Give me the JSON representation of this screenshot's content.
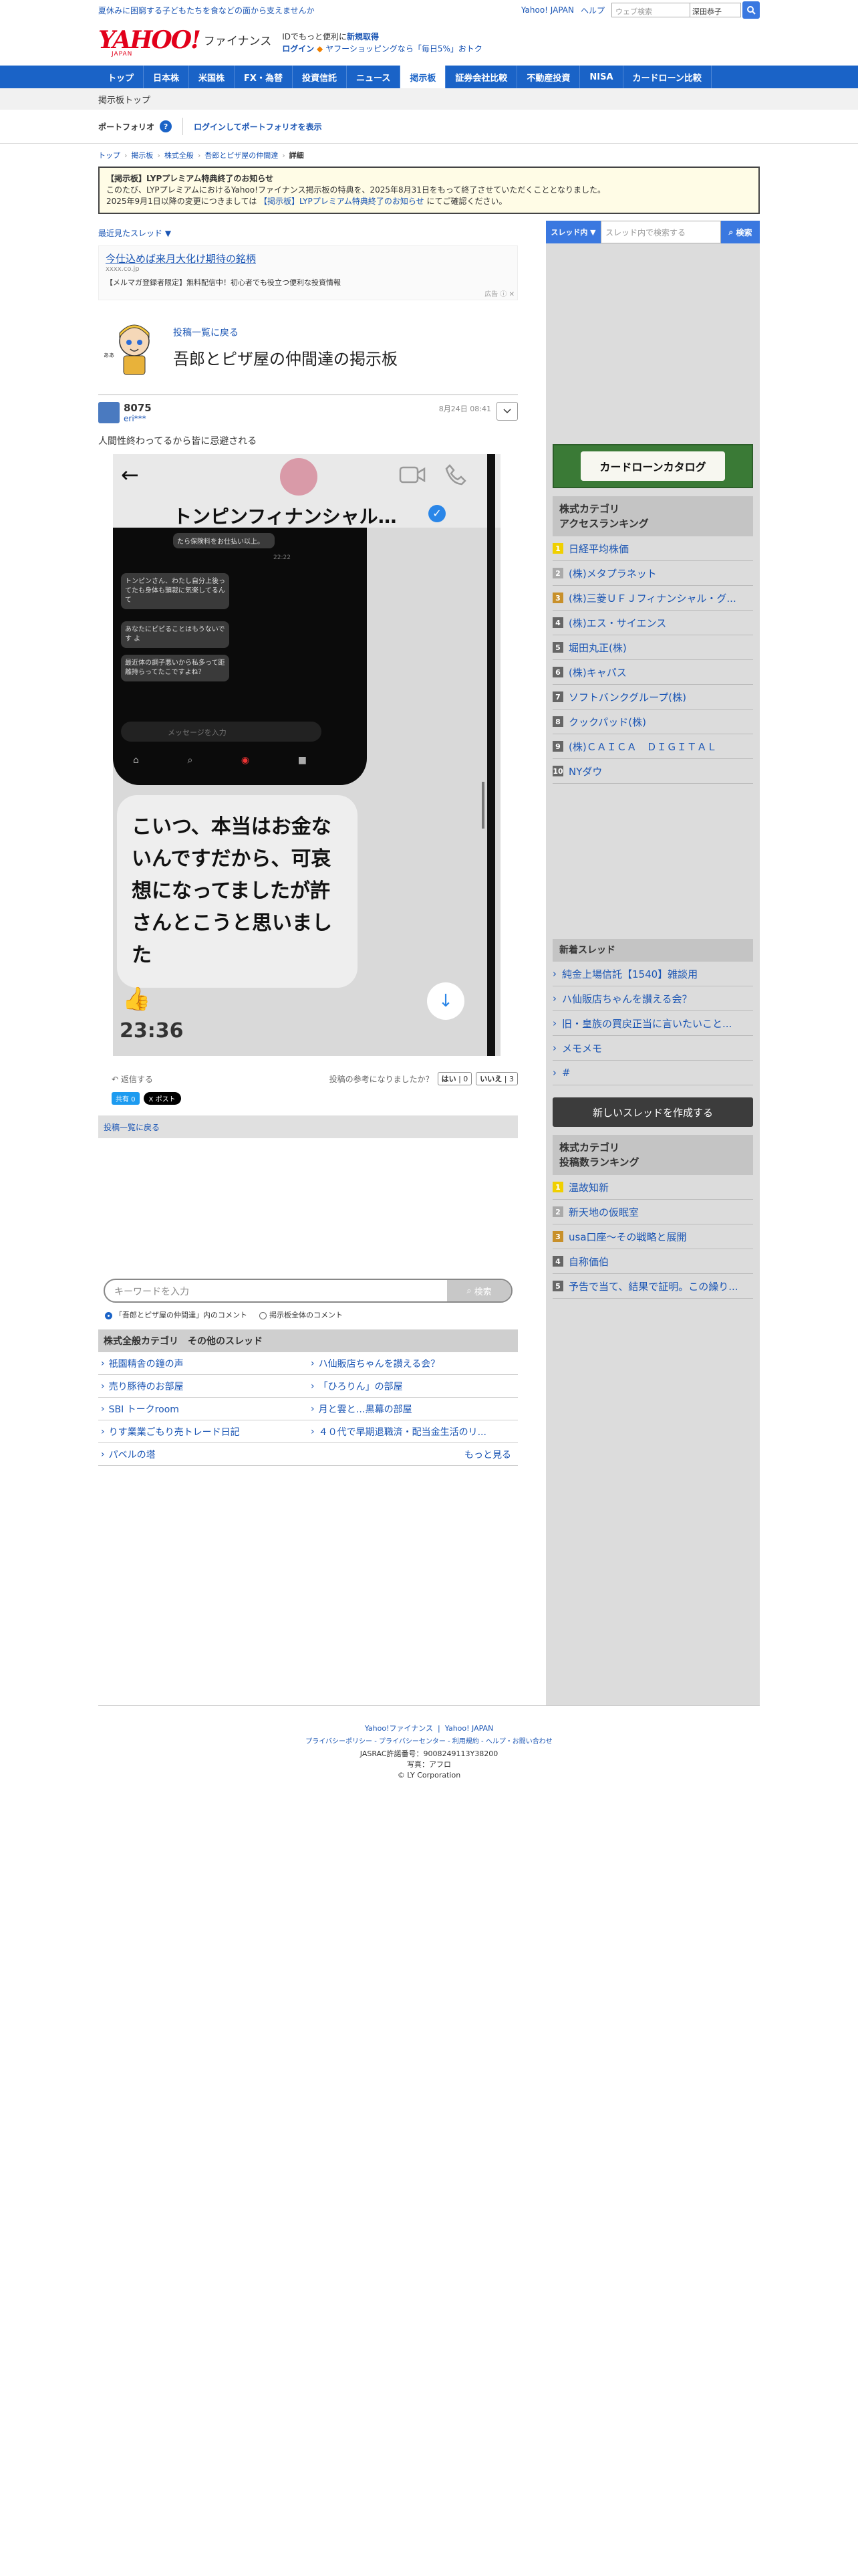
{
  "topbar": {
    "promo": "夏休みに困窮する子どもたちを食などの面から支えませんか",
    "links": [
      "Yahoo! JAPAN",
      "ヘルプ"
    ],
    "websearch_placeholder": "ウェブ検索",
    "user_label": "深田恭子"
  },
  "header": {
    "logo": "YAHOO!",
    "logo_sub": "JAPAN",
    "service": "ファイナンス",
    "msg_line1_pre": "IDでもっと便利に",
    "msg_line1_link": "新規取得",
    "msg_line2_login": "ログイン",
    "msg_line2_rest": "ヤフーショッピングなら「毎日5%」おトク"
  },
  "gnav": [
    "トップ",
    "日本株",
    "米国株",
    "FX・為替",
    "投資信託",
    "ニュース",
    "掲示板",
    "証券会社比較",
    "不動産投資",
    "NISA",
    "カードローン比較"
  ],
  "gnav_active": 6,
  "subtitle": "掲示板トップ",
  "portfolio": {
    "label": "ポートフォリオ",
    "help": "?",
    "login_link": "ログインしてポートフォリオを表示"
  },
  "breadcrumb": [
    "トップ",
    "掲示板",
    "株式全般",
    "吾郎とピザ屋の仲間達",
    "詳細"
  ],
  "notice": {
    "title": "【掲示板】LYPプレミアム特典終了のお知らせ",
    "line1": "このたび、LYPプレミアムにおけるYahoo!ファイナンス掲示板の特典を、2025年8月31日をもって終了させていただくこととなりました。",
    "line2_pre": "2025年9月1日以降の変更につきましては",
    "line2_link": "【掲示板】LYPプレミアム特典終了のお知らせ",
    "line2_post": "にてご確認ください。"
  },
  "recent_sort": "最近見たスレッド ▼",
  "ad": {
    "title": "今仕込めば来月大化け期待の銘柄",
    "domain": "xxxx.co.jp",
    "text": "【メルマガ登録者限定】無料配信中！初心者でも役立つ便利な投資情報",
    "mark": "広告"
  },
  "board": {
    "back": "投稿一覧に戻る",
    "name": "吾郎とピザ屋の仲間達の掲示板"
  },
  "post": {
    "number": "8075",
    "user": "eri***",
    "date": "8月24日 08:41",
    "body": "人間性終わってるから皆に忌避される",
    "image": {
      "contact": "トンピンフィナンシャル…",
      "bubble_top": "たら保険料をお仕払い以上。",
      "time_small": "22:22",
      "bubbles": [
        "トンピンさん、わたし自分上後ってたも身体も頭裁に気楽してるんて",
        "あなたにピピることはもうないです よ",
        "最近体の調子悪いから私多って距離持らってたこですよね？"
      ],
      "input_placeholder": "メッセージを入力",
      "big_message": "こいつ、本当はお金ないんですだから、可哀想になってましたが許さんとこうと思いました",
      "clock": "23:36"
    },
    "reply": "返信する",
    "vote_question": "投稿の参考になりましたか？",
    "vote_yes": "はい",
    "vote_yes_count": "0",
    "vote_no": "いいえ",
    "vote_no_count": "3",
    "fb_label": "共有 0",
    "x_label": "X ポスト"
  },
  "back_to_list": "投稿一覧に戻る",
  "search": {
    "placeholder": "キーワードを入力",
    "button": "検索",
    "radio1": "「吾郎とピザ屋の仲間達」内のコメント",
    "radio2": "掲示板全体のコメント"
  },
  "category": {
    "title": "株式全般カテゴリ　その他のスレッド",
    "items": [
      "祇園精舎の鐘の声",
      "ハ仙販店ちゃんを讃える会？",
      "売り豚待のお部屋",
      "「ひろりん」の部屋",
      "SBI トークroom",
      "月と雲と…黒幕の部屋",
      "りす業業ごもり売トレード日記",
      "４０代で早期退職済・配当金生活のリ..."
    ],
    "last": "パベルの塔",
    "more": "もっと見る"
  },
  "side": {
    "search_select": "スレッド内 ▼",
    "search_placeholder": "スレッド内で検索する",
    "search_button": "検索",
    "loan_banner": "カードローンカタログ",
    "access_title": "株式カテゴリ\nアクセスランキング",
    "access_title_l1": "株式カテゴリ",
    "access_title_l2": "アクセスランキング",
    "access": [
      "日経平均株価",
      "(株)メタプラネット",
      "(株)三菱ＵＦＪフィナンシャル・グ...",
      "(株)エス・サイエンス",
      "堀田丸正(株)",
      "(株)キャパス",
      "ソフトバンクグループ(株)",
      "クックパッド(株)",
      "(株)ＣＡＩＣＡ　ＤＩＧＩＴＡＬ",
      "NYダウ"
    ],
    "new_title": "新着スレッド",
    "new_threads": [
      "純金上場信託【1540】雑談用",
      "ハ仙販店ちゃんを讃える会？",
      "旧・皇族の買戻正当に言いたいこと...",
      "メモメモ",
      "#"
    ],
    "create_button": "新しいスレッドを作成する",
    "post_title_l1": "株式カテゴリ",
    "post_title_l2": "投稿数ランキング",
    "post_rank": [
      "温故知新",
      "新天地の仮眠室",
      "usa口座〜その戦略と展開",
      "自称価伯",
      "予告で当て、結果で証明。この繰り..."
    ]
  },
  "footer": {
    "links1": [
      "Yahoo!ファイナンス",
      "Yahoo! JAPAN"
    ],
    "links2": [
      "プライバシーポリシー",
      "プライバシーセンター",
      "利用規約",
      "ヘルプ・お問い合わせ"
    ],
    "jasrac": "JASRAC許諾番号：9008249113Y38200",
    "photo": "写真：アフロ",
    "copyright": "© LY Corporation"
  }
}
